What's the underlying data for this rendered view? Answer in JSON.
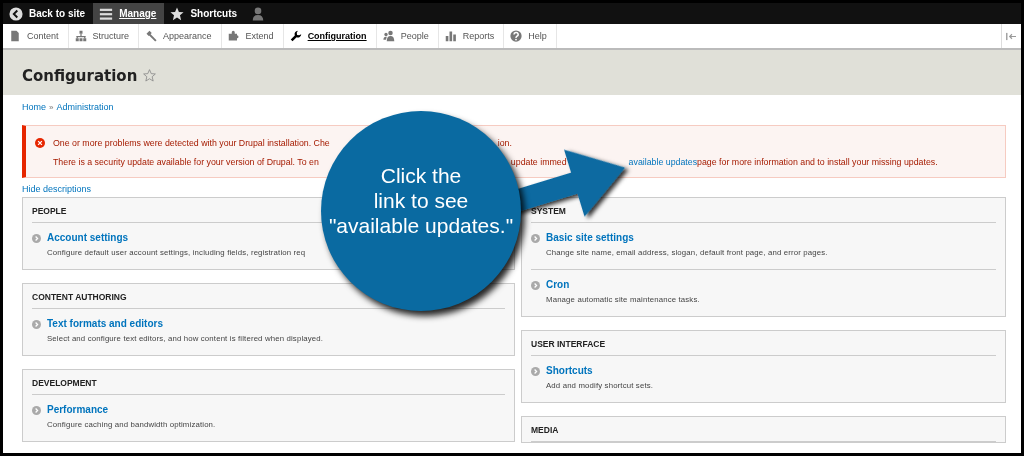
{
  "toolbar": {
    "items": [
      {
        "label": "Back to site",
        "kind": "back",
        "selected": false
      },
      {
        "label": "Manage",
        "kind": "menu",
        "selected": true
      },
      {
        "label": "Shortcuts",
        "kind": "star",
        "selected": false
      },
      {
        "kind": "user",
        "selected": false
      }
    ]
  },
  "tabs": [
    {
      "label": "Content",
      "kind": "content",
      "selected": false
    },
    {
      "label": "Structure",
      "kind": "structure",
      "selected": false
    },
    {
      "label": "Appearance",
      "kind": "appearance",
      "selected": false
    },
    {
      "label": "Extend",
      "kind": "extend",
      "selected": false
    },
    {
      "label": "Configuration",
      "kind": "configuration",
      "selected": true
    },
    {
      "label": "People",
      "kind": "people",
      "selected": false
    },
    {
      "label": "Reports",
      "kind": "reports",
      "selected": false
    },
    {
      "label": "Help",
      "kind": "help",
      "selected": false
    }
  ],
  "page_title": {
    "text": "Configuration",
    "favorite": false
  },
  "breadcrumb": {
    "items": [
      "Home",
      "Administration"
    ],
    "separator": "»"
  },
  "message": {
    "lines": [
      {
        "segments": [
          [
            {
              "kind": "text",
              "text": "One or more problems were detected with your Drupal installation. Che"
            }
          ],
          [
            {
              "kind": "text",
              "text": "ion."
            }
          ]
        ]
      },
      {
        "segments": [
          [
            {
              "kind": "text",
              "text": "There is a security update available for your version of Drupal. To en"
            }
          ],
          [
            {
              "kind": "text",
              "text": "update immed"
            }
          ],
          [
            {
              "kind": "link",
              "text": "available updates"
            },
            {
              "kind": "text",
              "text": " page for more information and to install your missing updates."
            }
          ]
        ]
      }
    ]
  },
  "hide_descriptions": "Hide descriptions",
  "columns": [
    {
      "panels": [
        {
          "title": "PEOPLE",
          "items": [
            {
              "title": "Account settings",
              "description": "Configure default user account settings, including fields, registration req"
            }
          ]
        },
        {
          "title": "CONTENT AUTHORING",
          "items": [
            {
              "title": "Text formats and editors",
              "description": "Select and configure text editors, and how content is filtered when displayed."
            }
          ]
        },
        {
          "title": "DEVELOPMENT",
          "items": [
            {
              "title": "Performance",
              "description": "Configure caching and bandwidth optimization."
            }
          ]
        }
      ]
    },
    {
      "panels": [
        {
          "title": "SYSTEM",
          "items": [
            {
              "title": "Basic site settings",
              "description": "Change site name, email address, slogan, default front page, and error pages."
            },
            {
              "title": "Cron",
              "description": "Manage automatic site maintenance tasks."
            }
          ]
        },
        {
          "title": "USER INTERFACE",
          "items": [
            {
              "title": "Shortcuts",
              "description": "Add and modify shortcut sets."
            }
          ]
        },
        {
          "title": "MEDIA"
        }
      ]
    }
  ],
  "callout": {
    "lines": [
      "Click the",
      "link to see",
      "\"available updates.\""
    ]
  }
}
